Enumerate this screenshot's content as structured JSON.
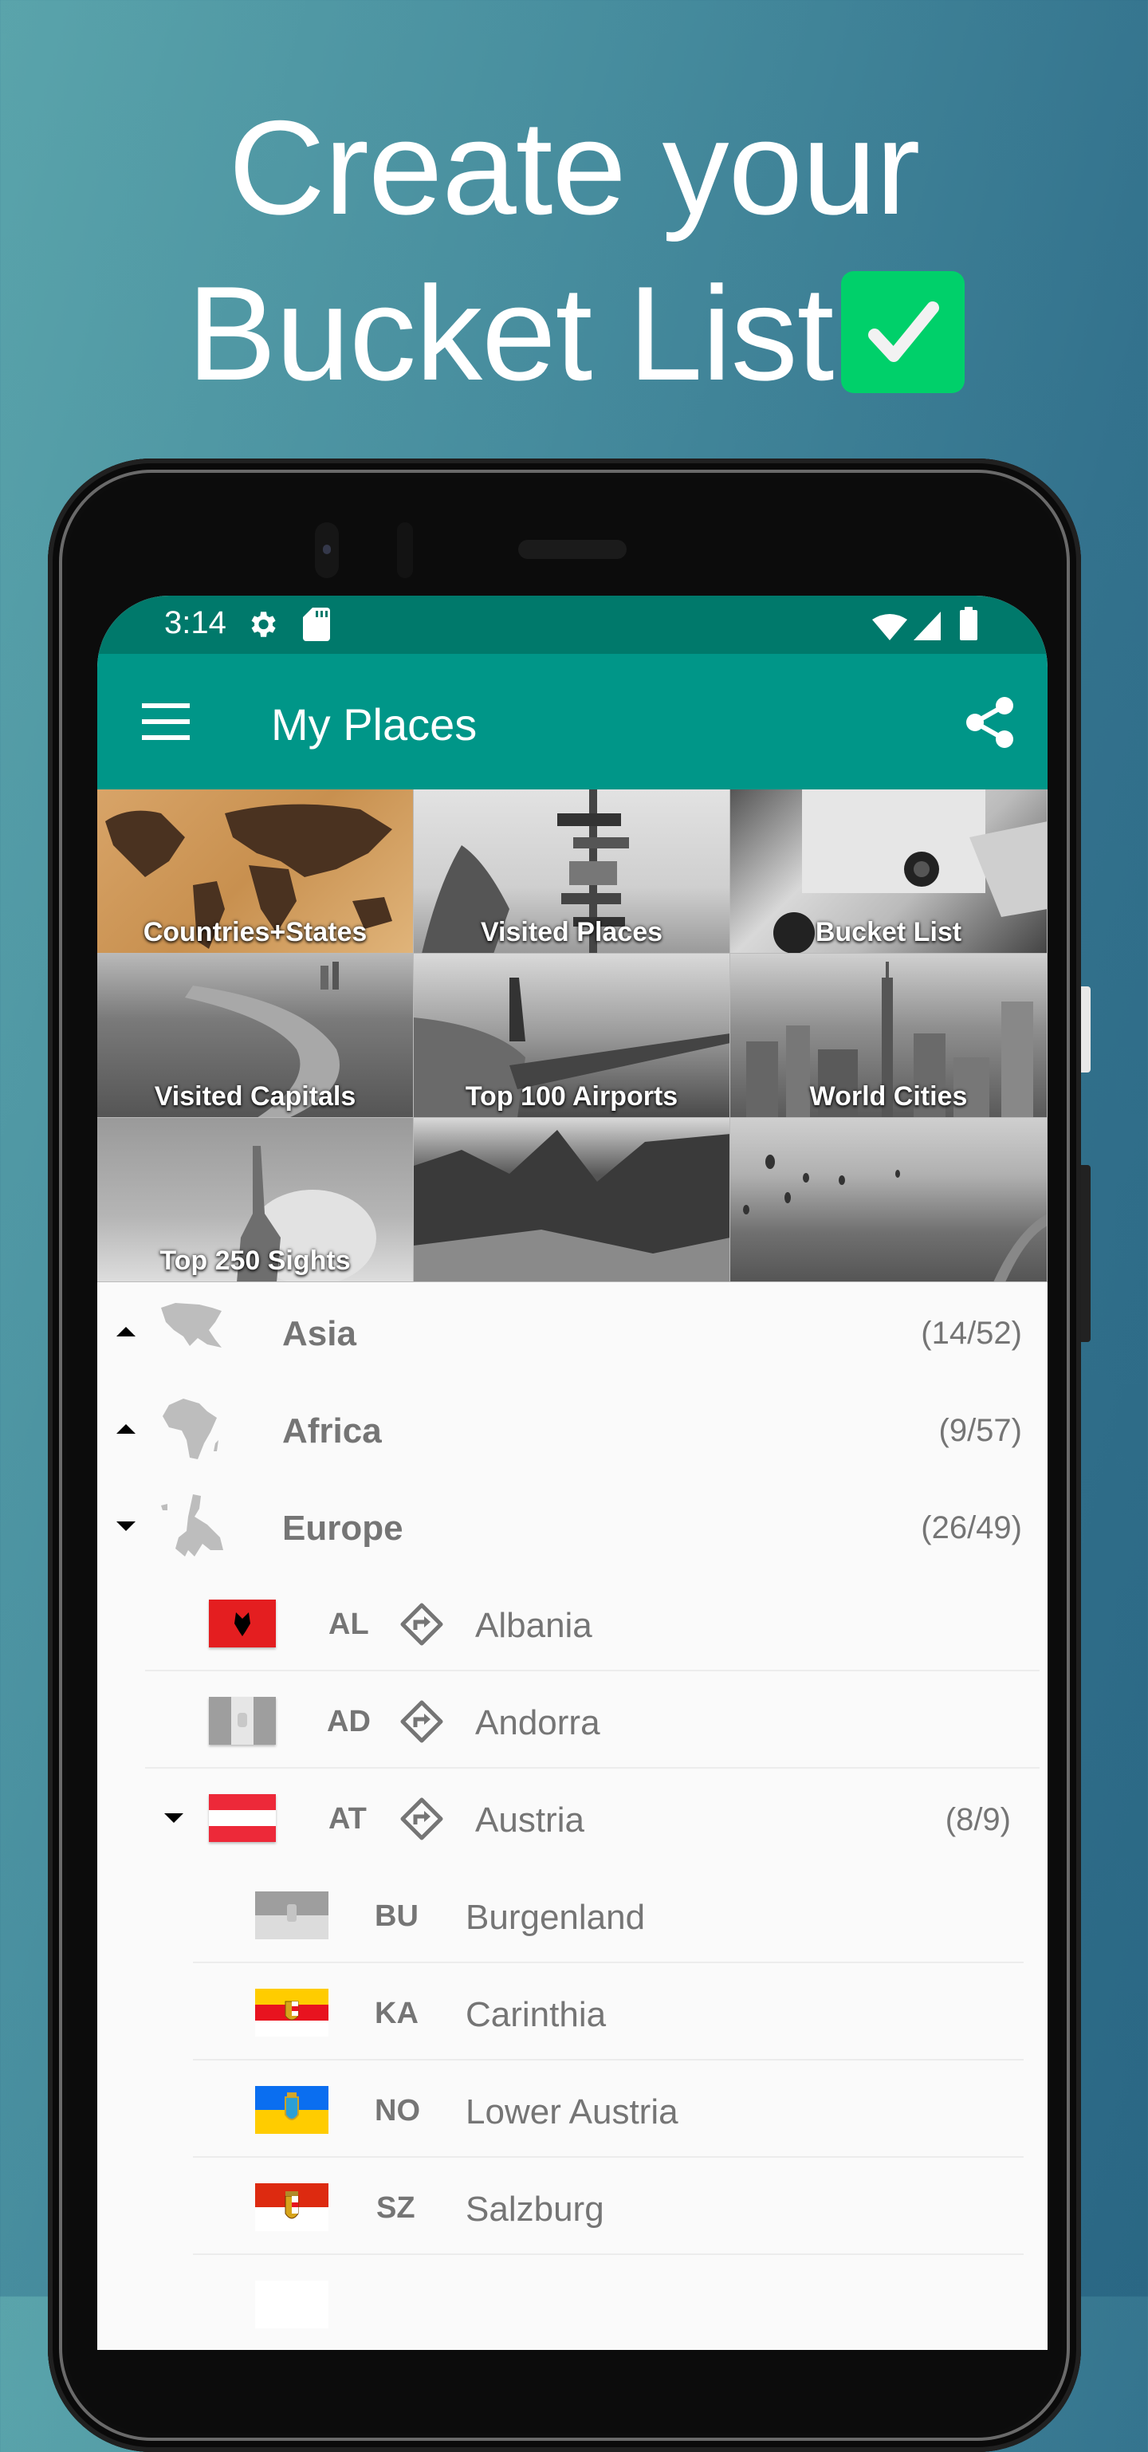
{
  "promo": {
    "line1": "Create your",
    "line2": "Bucket List",
    "check_icon": "checkbox-checked-icon",
    "check_color": "#00d06a"
  },
  "statusbar": {
    "time": "3:14",
    "icons": [
      "settings-icon",
      "sd-card-icon",
      "wifi-icon",
      "signal-icon",
      "battery-icon"
    ]
  },
  "appbar": {
    "title": "My Places",
    "menu_icon": "hamburger-menu-icon",
    "share_icon": "share-icon",
    "color": "#009688",
    "status_color": "#00796b"
  },
  "grid": {
    "tiles": [
      {
        "label": "Countries+States"
      },
      {
        "label": "Visited Places"
      },
      {
        "label": "Bucket List"
      },
      {
        "label": "Visited Capitals"
      },
      {
        "label": "Top 100 Airports"
      },
      {
        "label": "World Cities"
      },
      {
        "label": "Top 250 Sights"
      },
      {
        "label": ""
      },
      {
        "label": ""
      }
    ]
  },
  "continents": [
    {
      "name": "Asia",
      "count": "(14/52)",
      "expanded": false
    },
    {
      "name": "Africa",
      "count": "(9/57)",
      "expanded": false
    },
    {
      "name": "Europe",
      "count": "(26/49)",
      "expanded": true
    }
  ],
  "countries": [
    {
      "code": "AL",
      "name": "Albania",
      "count": ""
    },
    {
      "code": "AD",
      "name": "Andorra",
      "count": ""
    },
    {
      "code": "AT",
      "name": "Austria",
      "count": "(8/9)",
      "expanded": true
    }
  ],
  "states": [
    {
      "code": "BU",
      "name": "Burgenland"
    },
    {
      "code": "KA",
      "name": "Carinthia"
    },
    {
      "code": "NO",
      "name": "Lower Austria"
    },
    {
      "code": "SZ",
      "name": "Salzburg"
    }
  ]
}
